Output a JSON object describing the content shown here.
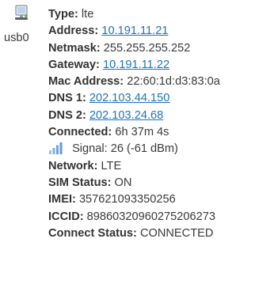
{
  "interface": {
    "name": "usb0",
    "icon": "network-interface-icon"
  },
  "rows": {
    "type": {
      "label": "Type:",
      "value": "lte"
    },
    "address": {
      "label": "Address:",
      "value": "10.191.11.21"
    },
    "netmask": {
      "label": "Netmask:",
      "value": "255.255.255.252"
    },
    "gateway": {
      "label": "Gateway:",
      "value": "10.191.11.22"
    },
    "mac": {
      "label": "Mac Address:",
      "value": "22:60:1d:d3:83:0a"
    },
    "dns1": {
      "label": "DNS 1:",
      "value": "202.103.44.150"
    },
    "dns2": {
      "label": "DNS 2:",
      "value": "202.103.24.68"
    },
    "connected": {
      "label": "Connected:",
      "value": "6h 37m 4s"
    },
    "signal": {
      "text": "Signal: 26 (-61 dBm)",
      "icon": "signal-strength-icon"
    },
    "network": {
      "label": "Network:",
      "value": "LTE"
    },
    "sim": {
      "label": "SIM Status:",
      "value": "ON"
    },
    "imei": {
      "label": "IMEI:",
      "value": "357621093350256"
    },
    "iccid": {
      "label": "ICCID:",
      "value": "89860320960275206273"
    },
    "connect_status": {
      "label": "Connect Status:",
      "value": "CONNECTED"
    }
  },
  "colors": {
    "link": "#1e73be",
    "label": "#333333",
    "text": "#3a3a3a",
    "signal_bars": "#5b9bd5"
  }
}
